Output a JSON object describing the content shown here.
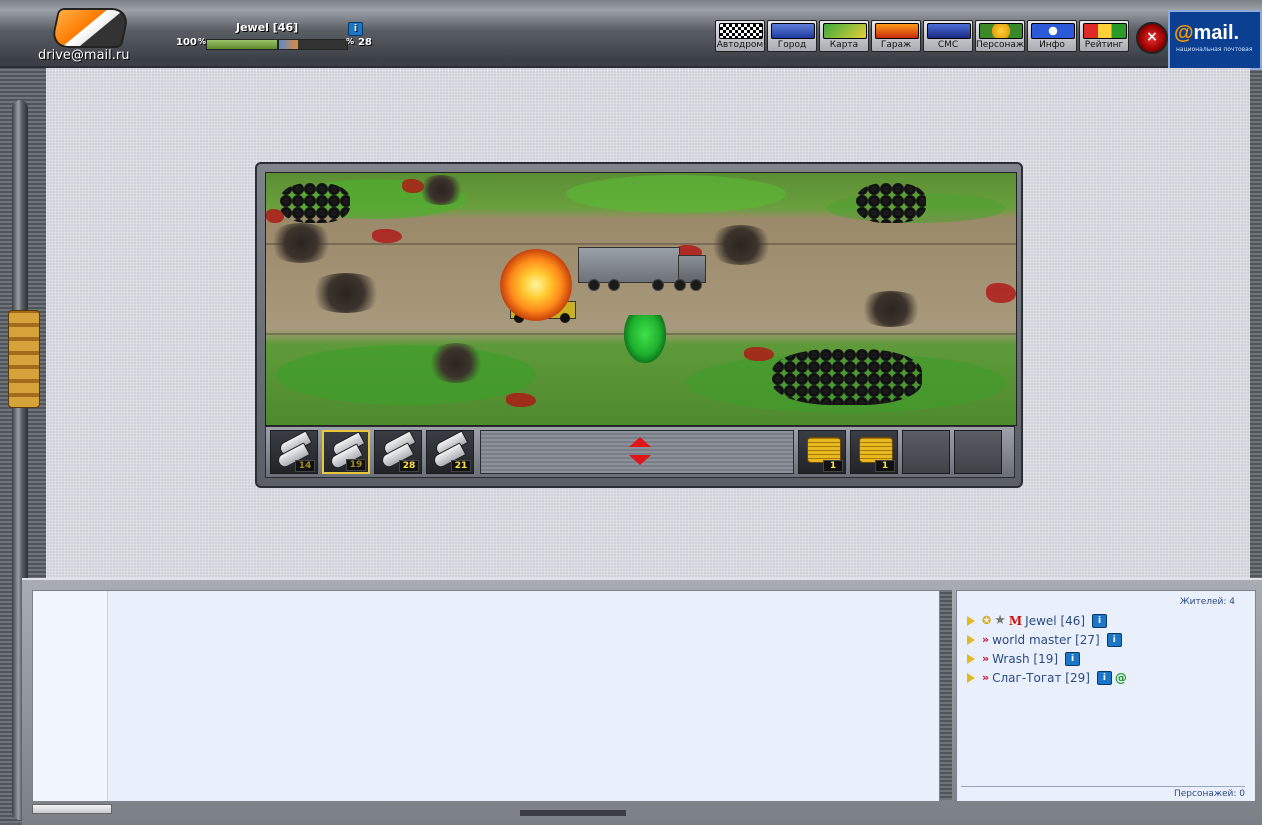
{
  "header": {
    "site": "drive@mail.ru",
    "player_name": "Jewel [46]",
    "info_icon": "i",
    "hp_label": "100",
    "hp_fraction": 1.0,
    "energy_label": "28",
    "energy_fraction": 0.28
  },
  "nav": {
    "items": [
      {
        "label": "Автодром",
        "icon": "checkered-flags-icon"
      },
      {
        "label": "Город",
        "icon": "city-icon"
      },
      {
        "label": "Карта",
        "icon": "map-icon"
      },
      {
        "label": "Гараж",
        "icon": "garage-icon"
      },
      {
        "label": "СМС",
        "icon": "sms-icon"
      },
      {
        "label": "Персонаж",
        "icon": "character-icon"
      },
      {
        "label": "Инфо",
        "icon": "info-icon"
      },
      {
        "label": "Рейтинг",
        "icon": "rating-icon"
      }
    ]
  },
  "mailru": {
    "brand_at": "@",
    "brand": "mail.",
    "tagline": "национальная почтовая"
  },
  "toolbar": {
    "weapons": [
      {
        "qty": "14",
        "selected": false,
        "dim": true
      },
      {
        "qty": "19",
        "selected": true,
        "dim": true
      },
      {
        "qty": "28",
        "selected": false,
        "dim": false
      },
      {
        "qty": "21",
        "selected": false,
        "dim": false
      }
    ],
    "items": [
      {
        "qty": "1",
        "type": "coins"
      },
      {
        "qty": "1",
        "type": "coins"
      },
      {
        "qty": "",
        "type": "empty"
      },
      {
        "qty": "",
        "type": "empty"
      }
    ]
  },
  "users": {
    "count_label": "Жителей: 4",
    "list": [
      {
        "name": "Jewel [46]",
        "has_at": false
      },
      {
        "name": "world master [27]",
        "has_at": false
      },
      {
        "name": "Wrash [19]",
        "has_at": false
      },
      {
        "name": "Слаг-Тогат [29]",
        "has_at": true
      }
    ],
    "footer": "Персонажей: 0"
  },
  "colors": {
    "accent_red": "#e0161a",
    "ammo_yellow": "#ffe23a",
    "chat_bg": "#eaf0fb",
    "user_text": "#2a4b86"
  }
}
